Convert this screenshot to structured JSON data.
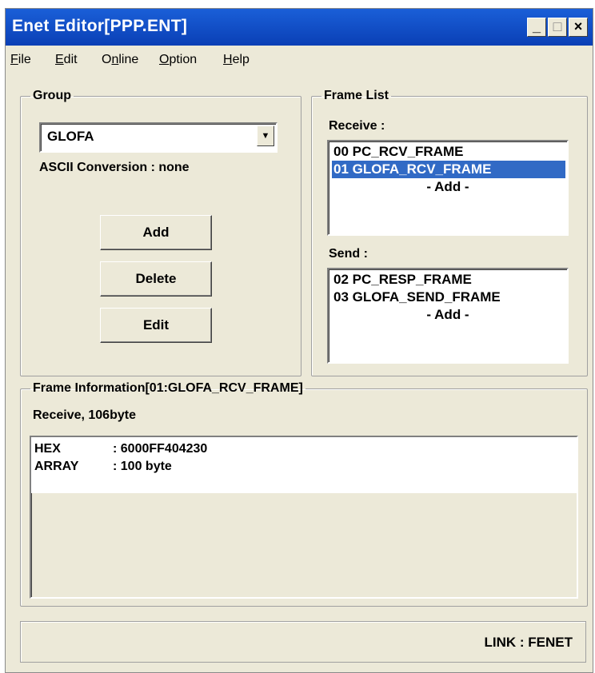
{
  "window": {
    "title": "Enet Editor[PPP.ENT]",
    "controls": {
      "minimize": "_",
      "maximize": "□",
      "close": "×"
    }
  },
  "menu": [
    {
      "accel": "F",
      "rest": "ile"
    },
    {
      "accel": "E",
      "rest": "dit"
    },
    {
      "pre": "O",
      "accel": "n",
      "rest": "line"
    },
    {
      "accel": "O",
      "rest": "ption"
    },
    {
      "accel": "H",
      "rest": "elp"
    }
  ],
  "group": {
    "legend": "Group",
    "selected": "GLOFA",
    "ascii_conversion": "ASCII Conversion : none",
    "buttons": {
      "add": "Add",
      "delete": "Delete",
      "edit": "Edit"
    }
  },
  "frame_list": {
    "legend": "Frame List",
    "receive_label": "Receive :",
    "receive_items": [
      "00 PC_RCV_FRAME",
      "01 GLOFA_RCV_FRAME"
    ],
    "receive_selected_index": 1,
    "receive_add": "- Add -",
    "send_label": "Send :",
    "send_items": [
      "02 PC_RESP_FRAME",
      "03 GLOFA_SEND_FRAME"
    ],
    "send_add": "- Add -"
  },
  "frame_info": {
    "legend": "Frame Information[01:GLOFA_RCV_FRAME]",
    "summary": "Receive, 106byte",
    "lines": [
      {
        "key": "HEX",
        "value": ": 6000FF404230"
      },
      {
        "key": "ARRAY",
        "value": ": 100 byte"
      }
    ]
  },
  "status": {
    "link": "LINK : FENET"
  },
  "colors": {
    "title_bar": "#0a3fb5",
    "selection": "#316ac5",
    "face": "#ece9d8"
  }
}
